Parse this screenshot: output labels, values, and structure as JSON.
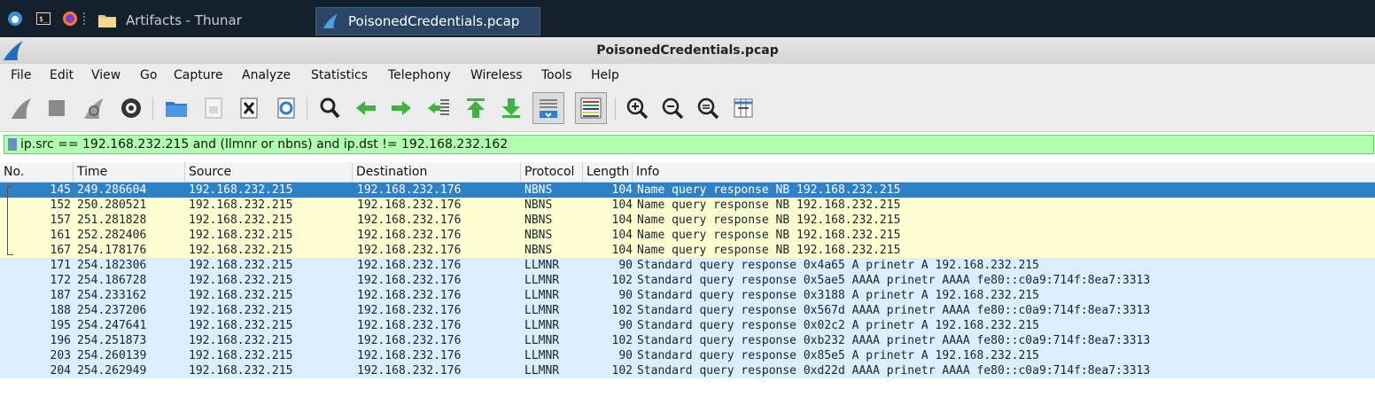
{
  "taskbar": {
    "items": [
      {
        "label": "Artifacts - Thunar",
        "icon": "folder-icon"
      },
      {
        "label": "PoisonedCredentials.pcap",
        "icon": "wireshark-fin-icon"
      }
    ]
  },
  "window": {
    "title": "PoisonedCredentials.pcap"
  },
  "menu": [
    "File",
    "Edit",
    "View",
    "Go",
    "Capture",
    "Analyze",
    "Statistics",
    "Telephony",
    "Wireless",
    "Tools",
    "Help"
  ],
  "toolbar": {
    "icons": [
      "start-capture-icon",
      "stop-capture-icon",
      "restart-capture-icon",
      "capture-options-icon",
      "open-file-icon",
      "save-file-icon",
      "close-file-icon",
      "reload-file-icon",
      "find-packet-icon",
      "go-back-icon",
      "go-forward-icon",
      "go-to-packet-icon",
      "go-first-icon",
      "go-last-icon",
      "auto-scroll-icon",
      "colorize-icon",
      "zoom-in-icon",
      "zoom-out-icon",
      "zoom-reset-icon",
      "resize-columns-icon"
    ]
  },
  "filter": {
    "value": "ip.src == 192.168.232.215 and (llmnr or nbns) and ip.dst != 192.168.232.162"
  },
  "columns": [
    "No.",
    "Time",
    "Source",
    "Destination",
    "Protocol",
    "Length",
    "Info"
  ],
  "packets": [
    {
      "no": "145",
      "time": "249.286604",
      "src": "192.168.232.215",
      "dst": "192.168.232.176",
      "proto": "NBNS",
      "len": "104",
      "info": "Name query response NB 192.168.232.215"
    },
    {
      "no": "152",
      "time": "250.280521",
      "src": "192.168.232.215",
      "dst": "192.168.232.176",
      "proto": "NBNS",
      "len": "104",
      "info": "Name query response NB 192.168.232.215"
    },
    {
      "no": "157",
      "time": "251.281828",
      "src": "192.168.232.215",
      "dst": "192.168.232.176",
      "proto": "NBNS",
      "len": "104",
      "info": "Name query response NB 192.168.232.215"
    },
    {
      "no": "161",
      "time": "252.282406",
      "src": "192.168.232.215",
      "dst": "192.168.232.176",
      "proto": "NBNS",
      "len": "104",
      "info": "Name query response NB 192.168.232.215"
    },
    {
      "no": "167",
      "time": "254.178176",
      "src": "192.168.232.215",
      "dst": "192.168.232.176",
      "proto": "NBNS",
      "len": "104",
      "info": "Name query response NB 192.168.232.215"
    },
    {
      "no": "171",
      "time": "254.182306",
      "src": "192.168.232.215",
      "dst": "192.168.232.176",
      "proto": "LLMNR",
      "len": "90",
      "info": "Standard query response 0x4a65 A prinetr A 192.168.232.215"
    },
    {
      "no": "172",
      "time": "254.186728",
      "src": "192.168.232.215",
      "dst": "192.168.232.176",
      "proto": "LLMNR",
      "len": "102",
      "info": "Standard query response 0x5ae5 AAAA prinetr AAAA fe80::c0a9:714f:8ea7:3313"
    },
    {
      "no": "187",
      "time": "254.233162",
      "src": "192.168.232.215",
      "dst": "192.168.232.176",
      "proto": "LLMNR",
      "len": "90",
      "info": "Standard query response 0x3188 A prinetr A 192.168.232.215"
    },
    {
      "no": "188",
      "time": "254.237206",
      "src": "192.168.232.215",
      "dst": "192.168.232.176",
      "proto": "LLMNR",
      "len": "102",
      "info": "Standard query response 0x567d AAAA prinetr AAAA fe80::c0a9:714f:8ea7:3313"
    },
    {
      "no": "195",
      "time": "254.247641",
      "src": "192.168.232.215",
      "dst": "192.168.232.176",
      "proto": "LLMNR",
      "len": "90",
      "info": "Standard query response 0x02c2 A prinetr A 192.168.232.215"
    },
    {
      "no": "196",
      "time": "254.251873",
      "src": "192.168.232.215",
      "dst": "192.168.232.176",
      "proto": "LLMNR",
      "len": "102",
      "info": "Standard query response 0xb232 AAAA prinetr AAAA fe80::c0a9:714f:8ea7:3313"
    },
    {
      "no": "203",
      "time": "254.260139",
      "src": "192.168.232.215",
      "dst": "192.168.232.176",
      "proto": "LLMNR",
      "len": "90",
      "info": "Standard query response 0x85e5 A prinetr A 192.168.232.215"
    },
    {
      "no": "204",
      "time": "254.262949",
      "src": "192.168.232.215",
      "dst": "192.168.232.176",
      "proto": "LLMNR",
      "len": "102",
      "info": "Standard query response 0xd22d AAAA prinetr AAAA fe80::c0a9:714f:8ea7:3313"
    }
  ],
  "colors": {
    "nbns_row": "#fefed0",
    "llmnr_row": "#daeeff",
    "selected_row": "#2f80c5",
    "filter_valid": "#afffaf"
  }
}
